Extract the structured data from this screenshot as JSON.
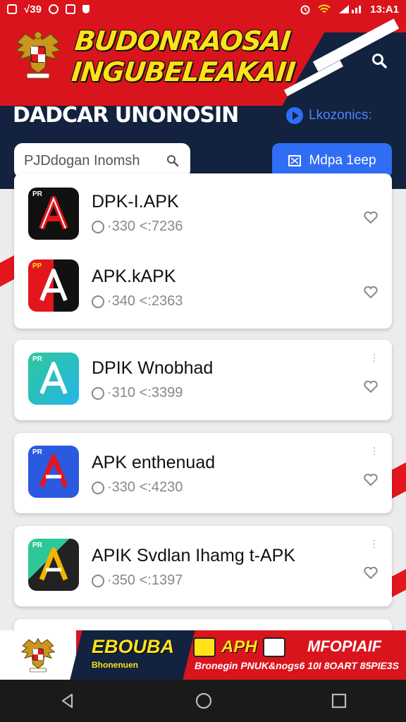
{
  "status_bar": {
    "left_text": "√39",
    "time": "13:A1"
  },
  "header": {
    "title_line1": "BUDONRAOSAI",
    "title_line2": "INGUBELEAKAII",
    "subtitle": "DADCAR UNONOSIN",
    "link_label": "Lkozonics:",
    "search_placeholder": "PJDdogan Inomsh",
    "action_button_label": "Mdpa 1eep"
  },
  "apps": [
    {
      "name": "DPK-I.APK",
      "meta": "·330 <:7236",
      "icon_bg": "#111111",
      "accent": "#e3161d"
    },
    {
      "name": "APK.kAPK",
      "meta": "·340 <:2363",
      "icon_bg": "#e3161d",
      "accent": "#ffffff"
    },
    {
      "name": "DPIK Wnobhad",
      "meta": "·310 <:3399",
      "icon_bg": "#25b6e8",
      "accent": "#2ec79a"
    },
    {
      "name": "APK enthenuad",
      "meta": "·330 <:4230",
      "icon_bg": "#2b59e0",
      "accent": "#e3161d"
    },
    {
      "name": "APIK Svdlan Ihamg t-APK",
      "meta": "·350 <:1397",
      "icon_bg": "#222222",
      "accent": "#f2b600"
    }
  ],
  "banner": {
    "seg1": "EBOUBA",
    "seg1_sub": "Bhonenuen",
    "seg2": "APH",
    "seg3": "MFOPIAIF",
    "strip": "Bronegin PNUK&nogs6 10I 8OART 85PIE3S"
  },
  "colors": {
    "brand_red": "#d9141c",
    "navy": "#13223e",
    "accent_blue": "#2f6df5",
    "title_yellow": "#ffe21a"
  },
  "icons": {
    "search": "magnifier-icon",
    "heart": "heart-icon",
    "nav": [
      "back-icon",
      "home-icon",
      "recents-icon"
    ]
  }
}
